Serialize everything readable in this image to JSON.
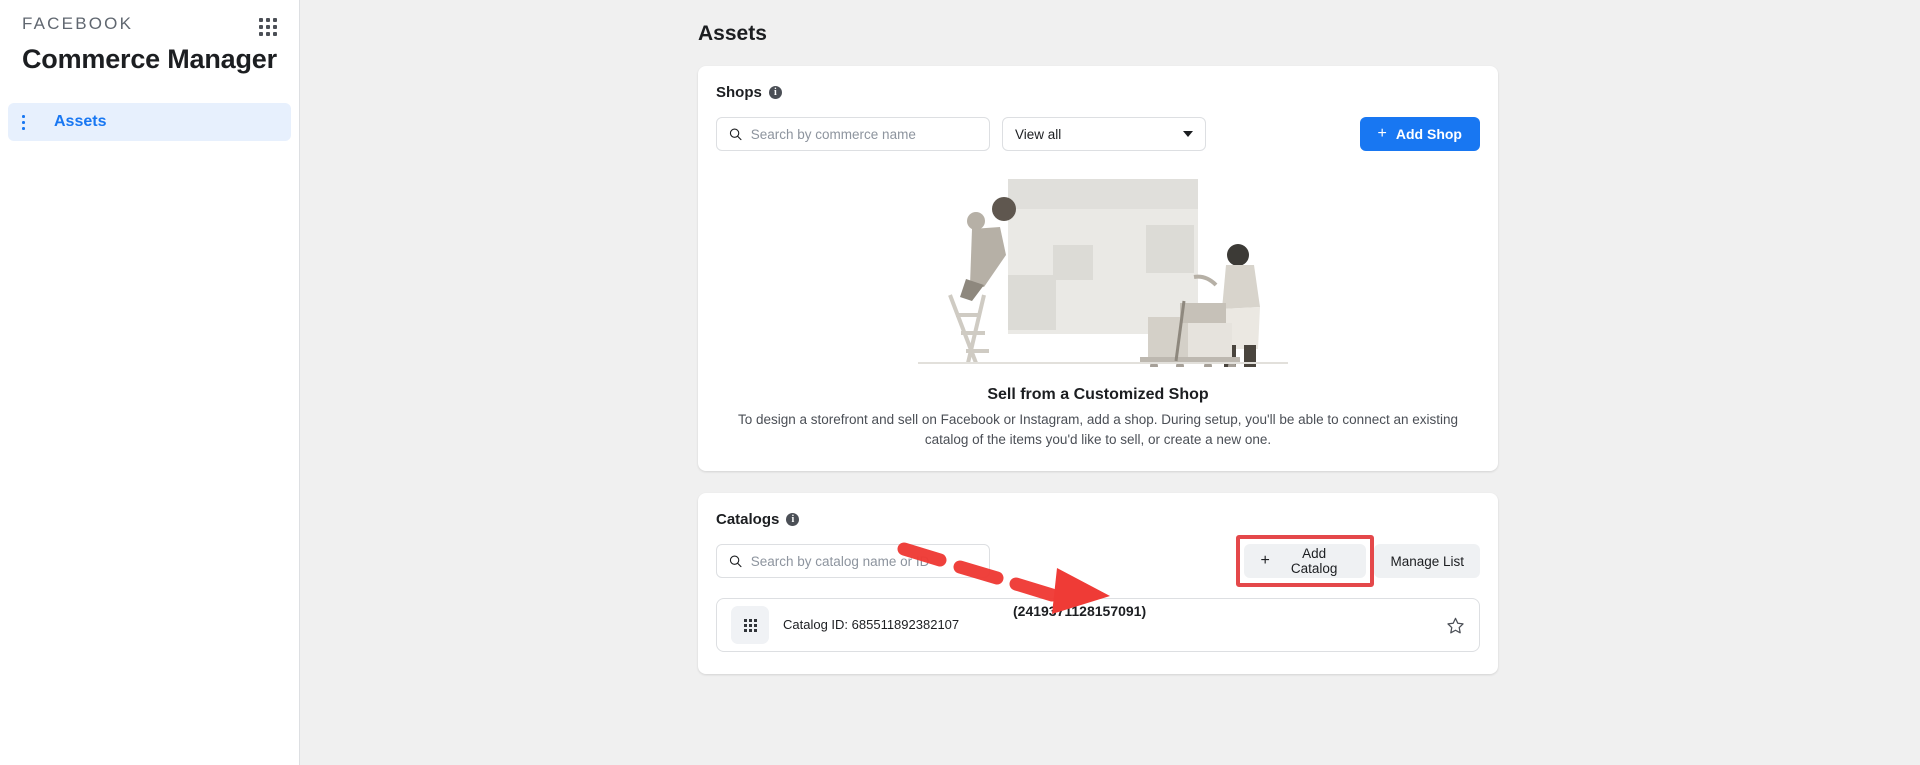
{
  "sidebar": {
    "brand_label": "FACEBOOK",
    "app_title": "Commerce Manager",
    "apps_grid_icon": "grid-apps-icon",
    "nav": [
      {
        "label": "Assets",
        "icon": "list-icon",
        "active": true
      }
    ]
  },
  "main": {
    "page_title": "Assets",
    "shops": {
      "heading": "Shops",
      "info_icon": "info-icon",
      "search": {
        "icon": "search-icon",
        "value": "",
        "placeholder": "Search by commerce name"
      },
      "filter": {
        "selected": "View all",
        "caret_icon": "chevron-down-icon"
      },
      "add_button": {
        "label": "Add Shop",
        "plus": "+",
        "color": "#1877f2"
      },
      "empty_state": {
        "illustration": "storefront-setup-illustration",
        "title": "Sell from a Customized Shop",
        "description": "To design a storefront and sell on Facebook or Instagram, add a shop. During setup, you'll be able to connect an existing catalog of the items you'd like to sell, or create a new one."
      }
    },
    "catalogs": {
      "heading": "Catalogs",
      "info_icon": "info-icon",
      "search": {
        "icon": "search-icon",
        "value": "",
        "placeholder": "Search by catalog name or ID"
      },
      "add_button": {
        "label": "Add Catalog",
        "plus": "+"
      },
      "manage_button": {
        "label": "Manage List"
      },
      "annotation": {
        "arrow_icon": "dashed-arrow-icon",
        "highlight_color": "#e4484a"
      },
      "rows": [
        {
          "thumb_icon": "catalog-grid-icon",
          "name": "(2419371128157091)",
          "id_label": "Catalog ID: 685511892382107",
          "star_icon": "star-outline-icon"
        }
      ]
    }
  }
}
